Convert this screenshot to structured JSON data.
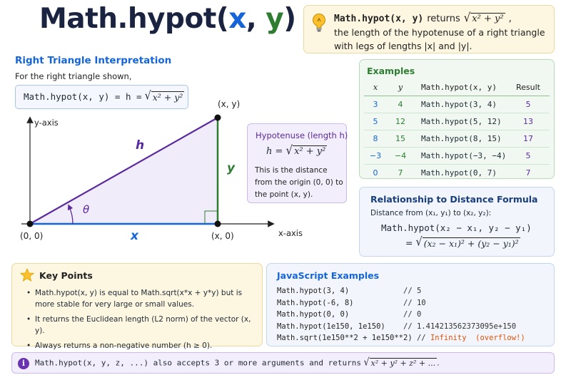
{
  "title": {
    "prefix": "Math.hypot(",
    "x": "x",
    "sep": ", ",
    "y": "y",
    "suffix": ")"
  },
  "tip": {
    "fn": "Math.hypot(x, y)",
    "returns": "returns",
    "sqrt_expr": "x² + y²",
    "line2": "the length of the hypotenuse of a right triangle",
    "line3": "with legs of lengths |x| and |y|.",
    "icon": "lightbulb-icon"
  },
  "interpretation": {
    "title": "Right Triangle Interpretation",
    "intro": "For the right triangle shown,",
    "formula_lhs": "Math.hypot(x, y) = h =",
    "formula_sqrt": "x² + y²"
  },
  "diagram": {
    "y_axis_label": "y-axis",
    "x_axis_label": "x-axis",
    "origin_label": "(0, 0)",
    "x_point_label": "(x, 0)",
    "top_point_label": "(x, y)",
    "h_label": "h",
    "x_label": "x",
    "y_label": "y",
    "theta_label": "θ"
  },
  "hypotenuse": {
    "title": "Hypotenuse (length h)",
    "formula_lhs": "h =",
    "formula_sqrt": "x² + y²",
    "desc": "This is the distance from the origin (0, 0) to the point (x, y)."
  },
  "examples": {
    "title": "Examples",
    "headers": [
      "x",
      "y",
      "Math.hypot(x, y)",
      "Result"
    ],
    "rows": [
      [
        "3",
        "4",
        "Math.hypot(3, 4)",
        "5"
      ],
      [
        "5",
        "12",
        "Math.hypot(5, 12)",
        "13"
      ],
      [
        "8",
        "15",
        "Math.hypot(8, 15)",
        "17"
      ],
      [
        "−3",
        "−4",
        "Math.hypot(−3, −4)",
        "5"
      ],
      [
        "0",
        "7",
        "Math.hypot(0, 7)",
        "7"
      ]
    ]
  },
  "distance": {
    "title": "Relationship to Distance Formula",
    "sub": "Distance from (x₁, y₁) to (x₂, y₂):",
    "line1": "Math.hypot(x₂ − x₁, y₂ − y₁)",
    "line2_eq": "=",
    "line2_sqrt": "(x₂ − x₁)² + (y₂ − y₁)²"
  },
  "key_points": {
    "title": "Key Points",
    "icon": "star-icon",
    "items": [
      "Math.hypot(x, y) is equal to Math.sqrt(x*x + y*y) but is more stable for very large or small values.",
      "It returns the Euclidean length (L2 norm) of the vector (x, y).",
      "Always returns a non-negative number (h ≥ 0)."
    ]
  },
  "js": {
    "title": "JavaScript Examples",
    "lines": [
      {
        "code": "Math.hypot(3, 4)            ",
        "comment": "// 5"
      },
      {
        "code": "Math.hypot(-6, 8)           ",
        "comment": "// 10"
      },
      {
        "code": "Math.hypot(0, 0)            ",
        "comment": "// 0"
      },
      {
        "code": "Math.hypot(1e150, 1e150)    ",
        "comment": "// 1.414213562373095e+150"
      },
      {
        "code": "Math.sqrt(1e150**2 + 1e150**2) ",
        "comment": "// ",
        "warn": "Infinity  (overflow!)"
      }
    ]
  },
  "note": {
    "icon": "info-icon",
    "text": "Math.hypot(x, y, z, ...) also accepts 3 or more arguments and returns",
    "sqrt": "x² + y² + z² + ...",
    "end": "."
  },
  "colors": {
    "accent": "#1565d8",
    "green": "#2e7d32",
    "purple": "#5b2a9e",
    "warn": "#e65100"
  }
}
